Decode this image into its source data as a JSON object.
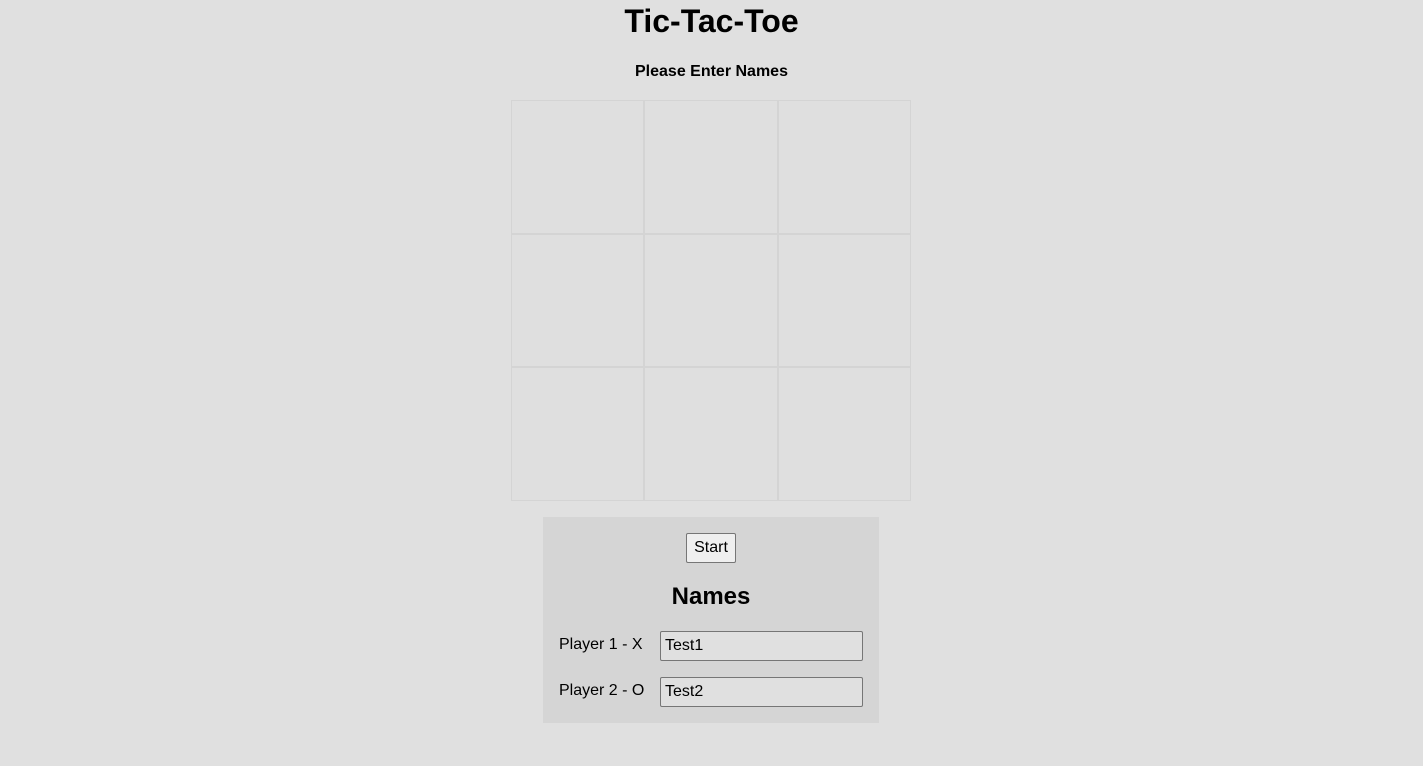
{
  "header": {
    "title": "Tic-Tac-Toe",
    "status": "Please Enter Names"
  },
  "board": {
    "cells": [
      "",
      "",
      "",
      "",
      "",
      "",
      "",
      "",
      ""
    ]
  },
  "controls": {
    "start_label": "Start"
  },
  "names": {
    "heading": "Names",
    "player1": {
      "label": "Player 1 - X",
      "value": "Test1"
    },
    "player2": {
      "label": "Player 2 - O",
      "value": "Test2"
    }
  },
  "colors": {
    "background": "#e0e0e0",
    "panel": "#d5d5d5",
    "cell_border": "#d4d4d4"
  }
}
